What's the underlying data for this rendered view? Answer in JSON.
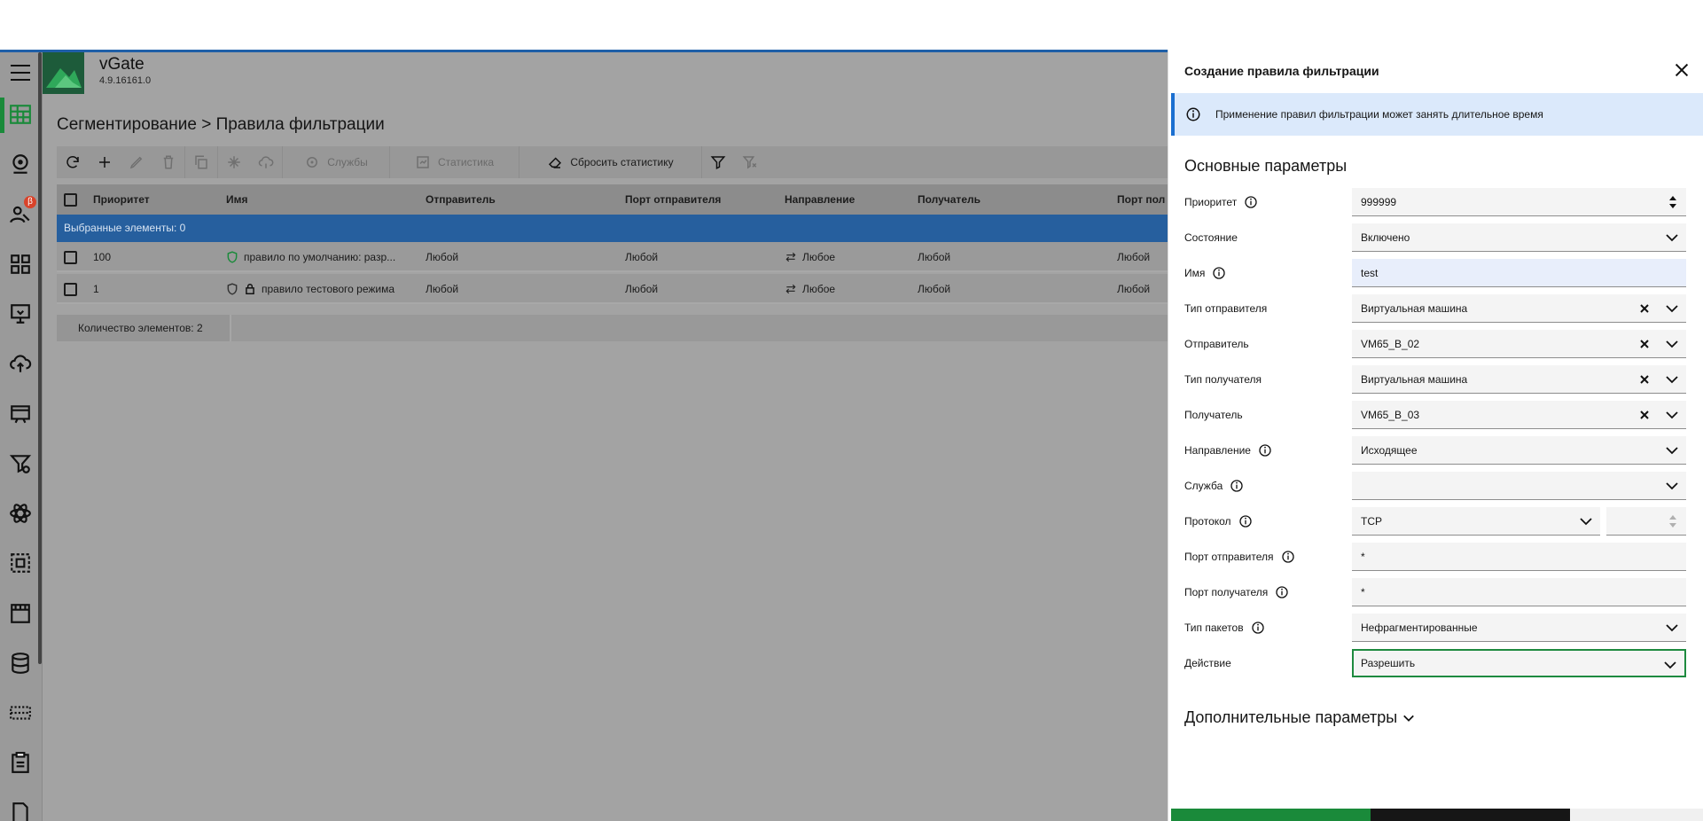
{
  "app": {
    "name": "vGate",
    "version": "4.9.16161.0"
  },
  "breadcrumb": "Сегментирование > Правила фильтрации",
  "toolbar": {
    "services_label": "Службы",
    "statistics_label": "Статистика",
    "reset_stats_label": "Сбросить статистику"
  },
  "table": {
    "columns": [
      "Приоритет",
      "Имя",
      "Отправитель",
      "Порт отправителя",
      "Направление",
      "Получатель",
      "Порт пол"
    ],
    "selected_text": "Выбранные элементы: 0",
    "rows": [
      {
        "priority": "100",
        "name": "правило по умолчанию: разр...",
        "sender": "Любой",
        "sender_port": "Любой",
        "direction": "Любое",
        "receiver": "Любой",
        "receiver_port": "Любой"
      },
      {
        "priority": "1",
        "name": "правило тестового режима",
        "sender": "Любой",
        "sender_port": "Любой",
        "direction": "Любое",
        "receiver": "Любой",
        "receiver_port": "Любой"
      }
    ],
    "count_text": "Количество элементов: 2"
  },
  "drawer": {
    "title": "Создание правила фильтрации",
    "info": "Применение правил фильтрации может занять длительное время",
    "section_main": "Основные параметры",
    "section_more": "Дополнительные параметры",
    "fields": {
      "priority": {
        "label": "Приоритет",
        "value": "999999"
      },
      "state": {
        "label": "Состояние",
        "value": "Включено"
      },
      "name": {
        "label": "Имя",
        "value": "test"
      },
      "sender_type": {
        "label": "Тип отправителя",
        "value": "Виртуальная машина"
      },
      "sender": {
        "label": "Отправитель",
        "value": "VM65_B_02"
      },
      "receiver_type": {
        "label": "Тип получателя",
        "value": "Виртуальная машина"
      },
      "receiver": {
        "label": "Получатель",
        "value": "VM65_B_03"
      },
      "direction": {
        "label": "Направление",
        "value": "Исходящее"
      },
      "service": {
        "label": "Служба",
        "value": ""
      },
      "protocol": {
        "label": "Протокол",
        "value": "TCP"
      },
      "sender_port": {
        "label": "Порт отправителя",
        "value": "*"
      },
      "receiver_port": {
        "label": "Порт получателя",
        "value": "*"
      },
      "packet_type": {
        "label": "Тип пакетов",
        "value": "Нефрагментированные"
      },
      "action": {
        "label": "Действие",
        "value": "Разрешить"
      }
    }
  },
  "colors": {
    "accent_green": "#1a8a3a",
    "selection_blue": "#265f9e",
    "info_blue": "#1b6fd0"
  }
}
